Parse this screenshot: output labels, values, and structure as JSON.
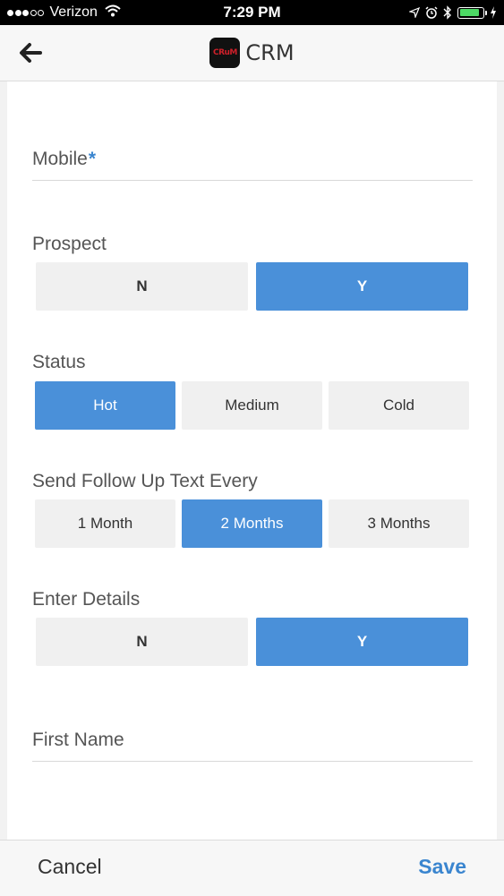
{
  "status_bar": {
    "carrier": "Verizon",
    "time": "7:29 PM",
    "signal_bars_filled": 3,
    "signal_bars_total": 5,
    "battery_level": 0.85,
    "battery_color": "#4cd964"
  },
  "nav": {
    "back_icon": "arrow-left-icon",
    "logo_text": "CRuM",
    "title": "CRM"
  },
  "form": {
    "mobile": {
      "label": "Mobile",
      "required_mark": "*",
      "value": ""
    },
    "prospect": {
      "label": "Prospect",
      "options": [
        "N",
        "Y"
      ],
      "selected": "Y"
    },
    "status": {
      "label": "Status",
      "options": [
        "Hot",
        "Medium",
        "Cold"
      ],
      "selected": "Hot"
    },
    "follow_up": {
      "label": "Send Follow Up Text Every",
      "options": [
        "1 Month",
        "2 Months",
        "3 Months"
      ],
      "selected": "2 Months"
    },
    "enter_details": {
      "label": "Enter Details",
      "options": [
        "N",
        "Y"
      ],
      "selected": "Y"
    },
    "first_name": {
      "label": "First Name",
      "value": ""
    }
  },
  "actions": {
    "cancel_label": "Cancel",
    "save_label": "Save"
  },
  "colors": {
    "accent": "#4a90d9",
    "link": "#3a85cf",
    "button_inactive": "#f0f0f0"
  }
}
